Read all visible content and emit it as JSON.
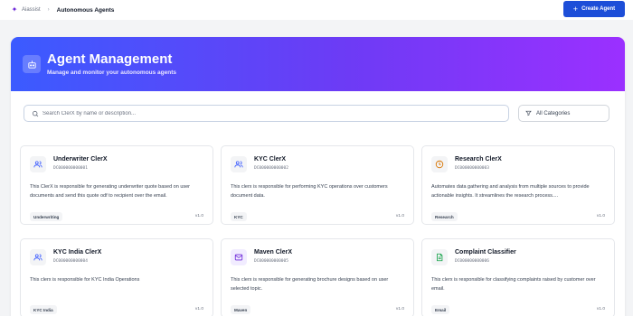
{
  "topbar": {
    "app_name": "Aiassist",
    "page_name": "Autonomous Agents",
    "create_label": "Create Agent"
  },
  "hero": {
    "title": "Agent Management",
    "subtitle": "Manage and monitor your autonomous agents"
  },
  "search": {
    "placeholder": "Search ClerX by name or description...",
    "value": ""
  },
  "filter": {
    "selected": "All Categories"
  },
  "colors": {
    "accent": "#1d4ed8",
    "hero_start": "#3b5bff",
    "hero_end": "#9b30ff"
  },
  "agents": [
    {
      "name": "Underwriter ClerX",
      "id": "DC000000000001",
      "description": "This ClerX is responsible for generating underwriter quote based on user documents and send this quote odf to recipient over the email.",
      "category": "Underwriting",
      "version": "v1.0",
      "icon": "users-icon"
    },
    {
      "name": "KYC ClerX",
      "id": "DC000000000002",
      "description": "This clerx is responsible for performing KYC operations over customers document data.",
      "category": "KYC",
      "version": "v1.0",
      "icon": "users-icon"
    },
    {
      "name": "Research ClerX",
      "id": "DC000000000003",
      "description": "Automates data gathering and analysis from multiple sources to provide actionable insights. It streamlines the research process....",
      "category": "Research",
      "version": "v1.0",
      "icon": "clock-icon"
    },
    {
      "name": "KYC India ClerX",
      "id": "DC000000000004",
      "description": "This clerx is responsible for KYC India Operations",
      "category": "KYC India",
      "version": "v1.0",
      "icon": "users-icon"
    },
    {
      "name": "Maven ClerX",
      "id": "DC000000000005",
      "description": "This clerx is responsible for generating brochure designs based on user selected topic.",
      "category": "Maven",
      "version": "v1.0",
      "icon": "mail-icon"
    },
    {
      "name": "Complaint Classifier",
      "id": "DC000000000006",
      "description": "This clerx is responsible for classifying complaints raised by customer over email.",
      "category": "Email",
      "version": "v1.0",
      "icon": "document-icon"
    }
  ]
}
